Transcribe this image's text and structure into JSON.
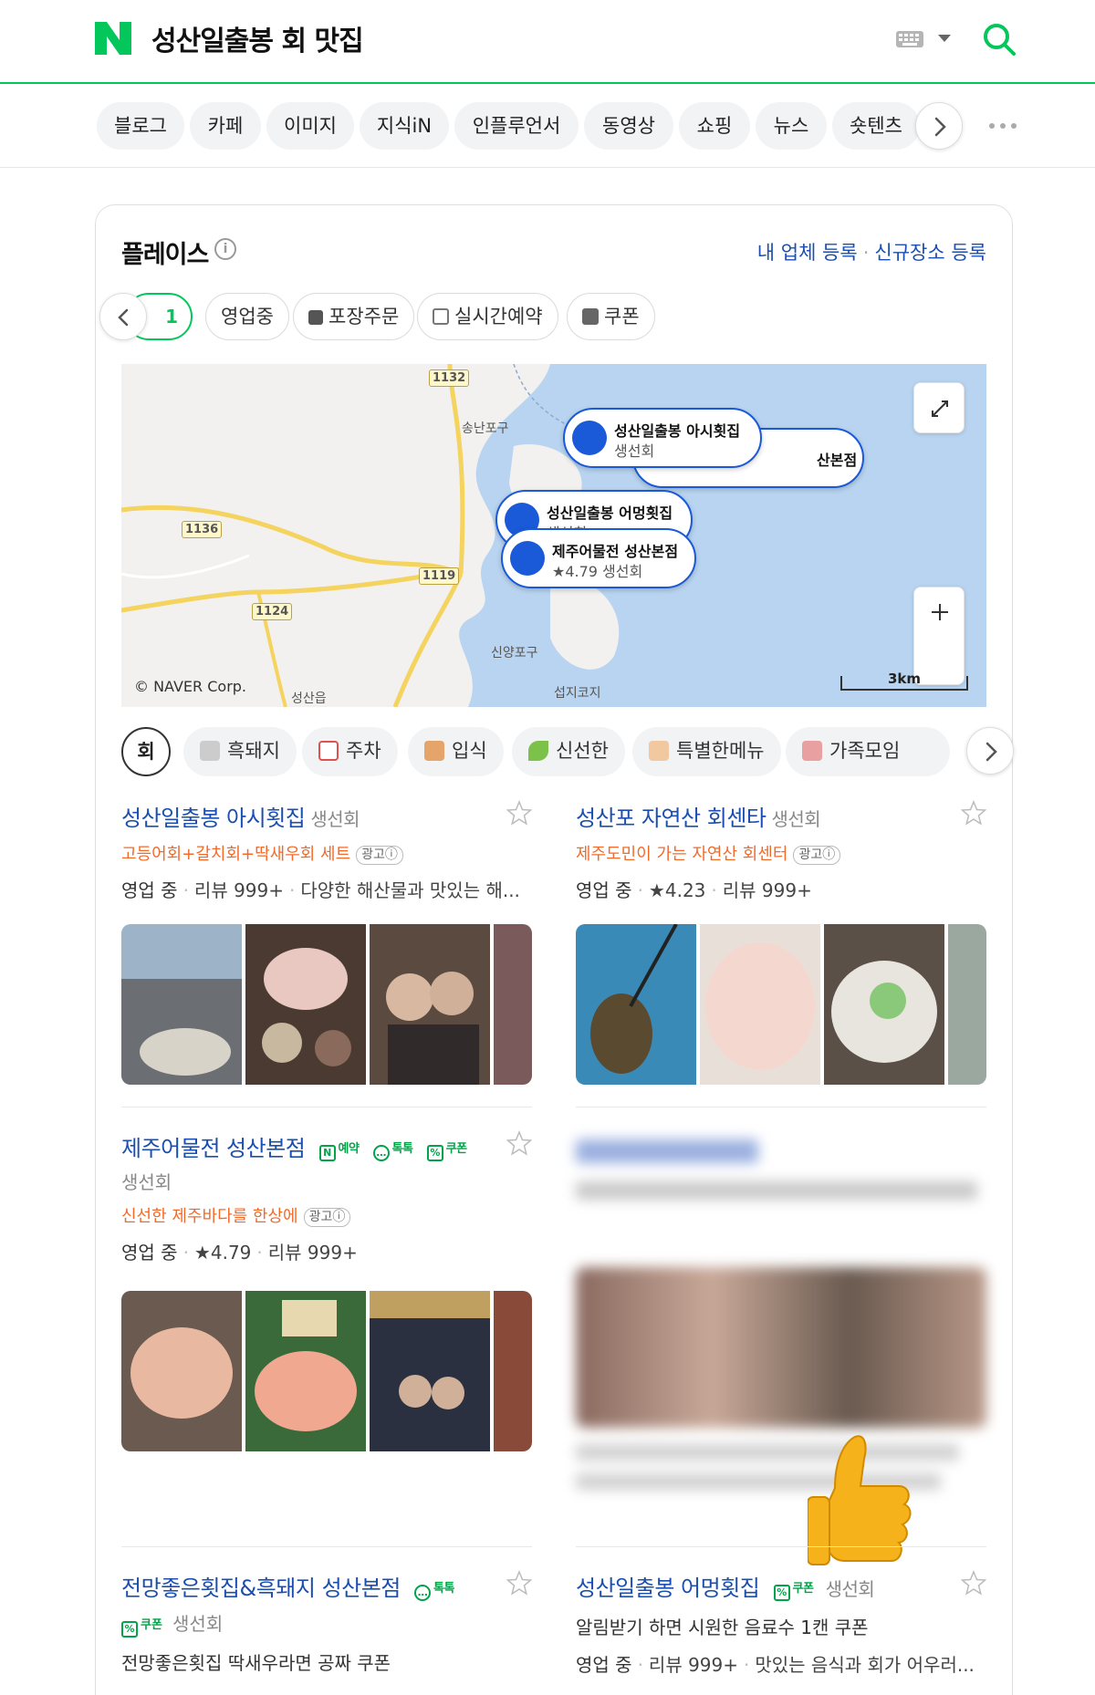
{
  "header": {
    "query": "성산일출봉 회 맛집",
    "logo_letter": "N"
  },
  "tabs": [
    "블로그",
    "카페",
    "이미지",
    "지식iN",
    "인플루언서",
    "동영상",
    "쇼핑",
    "뉴스",
    "숏텐츠"
  ],
  "panel": {
    "title": "플레이스",
    "link_register": "내 업체 등록",
    "link_new": "신규장소 등록",
    "filters": {
      "selected": "1",
      "chips": [
        "영업중",
        "포장주문",
        "실시간예약",
        "쿠폰"
      ]
    },
    "map": {
      "markers": [
        {
          "name": "성산일출봉 아시횟집",
          "category": "생선회"
        },
        {
          "name": "산본점",
          "category": ""
        },
        {
          "name": "성산일출봉 어멍횟집",
          "category": "생선회"
        },
        {
          "name": "제주어물전 성산본점",
          "category": "★4.79  생선회"
        }
      ],
      "labels": [
        "송난포구",
        "신양포구",
        "섭지코지",
        "성산읍"
      ],
      "road_signs": [
        "1132",
        "1136",
        "1119",
        "1124"
      ],
      "copyright": "© NAVER Corp.",
      "scale": "3km"
    },
    "categories": {
      "first": "회",
      "chips": [
        "흑돼지",
        "주차",
        "입식",
        "신선한",
        "특별한메뉴",
        "가족모임"
      ]
    }
  },
  "results": [
    {
      "name": "성산일출봉 아시횟집",
      "category": "생선회",
      "ad_text": "고등어회+갈치회+딱새우회 세트",
      "ad_badge": "광고ⓘ",
      "status": "영업 중",
      "reviews": "리뷰 999+",
      "extra": "다양한 해산물과 맛있는 해..."
    },
    {
      "name": "성산포 자연산 회센타",
      "category": "생선회",
      "ad_text": "제주도민이 가는 자연산 회센터",
      "ad_badge": "광고ⓘ",
      "status": "영업 중",
      "rating": "4.23",
      "reviews": "리뷰 999+"
    },
    {
      "name": "제주어물전 성산본점",
      "badges": [
        "예약",
        "톡톡",
        "쿠폰"
      ],
      "category": "생선회",
      "ad_text": "신선한 제주바다를 한상에",
      "ad_badge": "광고ⓘ",
      "status": "영업 중",
      "rating": "4.79",
      "reviews": "리뷰 999+"
    },
    {
      "name": "전망좋은횟집&흑돼지 성산본점",
      "badges": [
        "톡톡",
        "쿠폰"
      ],
      "category": "생선회",
      "desc": "전망좋은횟집 딱새우라면 공짜 쿠폰"
    },
    {
      "name": "성산일출봉 어멍횟집",
      "badges": [
        "쿠폰"
      ],
      "category": "생선회",
      "desc": "알림받기 하면 시원한 음료수 1캔 쿠폰",
      "status": "영업 중",
      "reviews": "리뷰 999+",
      "extra": "맛있는 음식과 회가 어우러..."
    }
  ],
  "colors": {
    "naver_green": "#03c75a",
    "link_blue": "#1a4fb0",
    "ad_orange": "#f26a2a",
    "map_sea": "#b8d4f0",
    "marker_blue": "#1a5ad8"
  }
}
